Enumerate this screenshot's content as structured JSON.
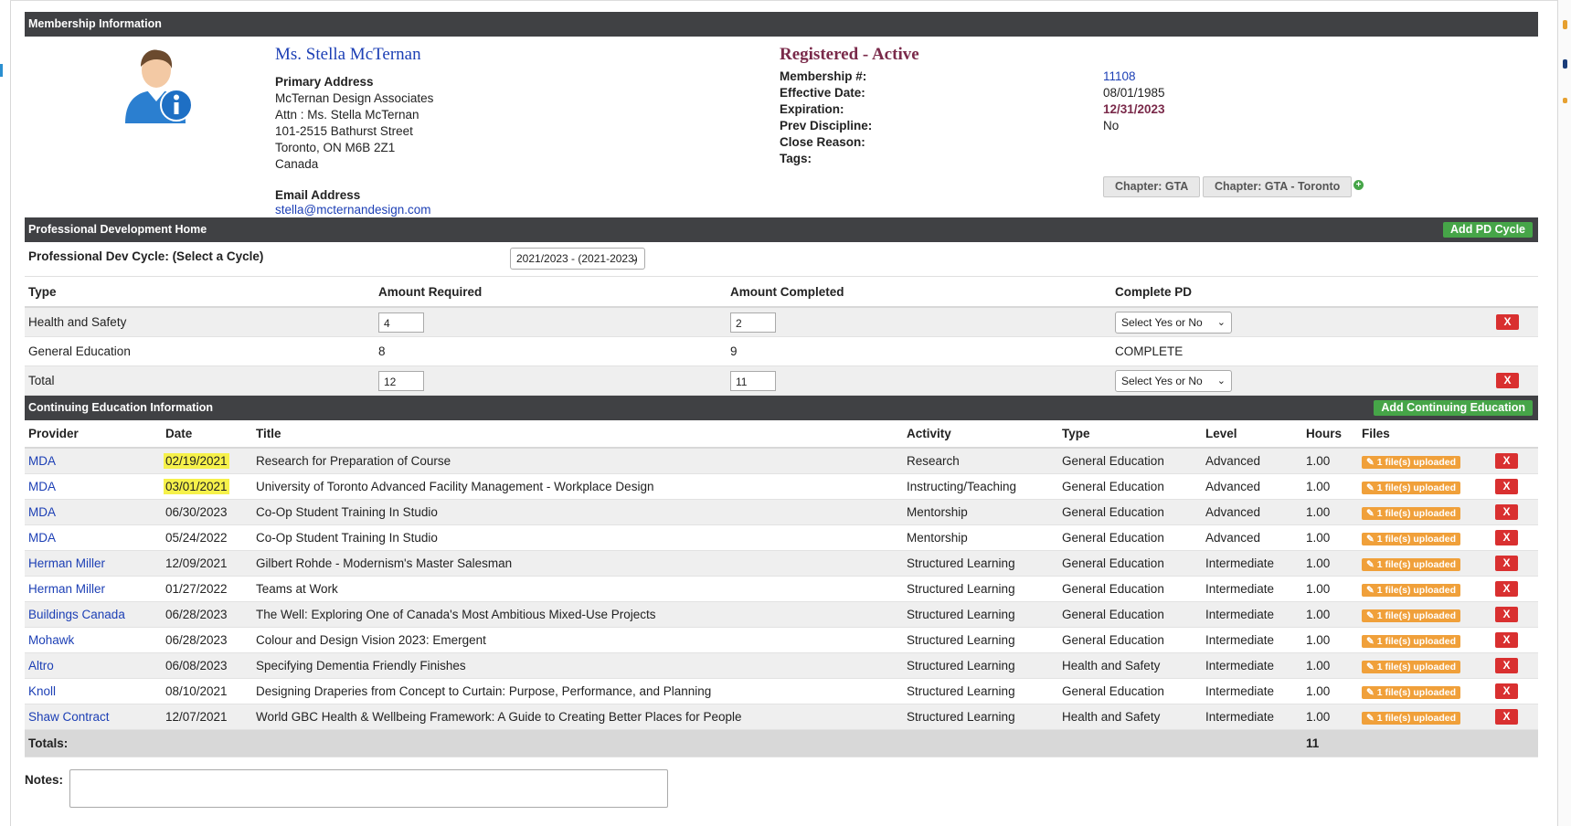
{
  "membership": {
    "section_title": "Membership Information",
    "name": "Ms. Stella McTernan",
    "primary_address_label": "Primary Address",
    "address_lines": [
      "McTernan Design Associates",
      "Attn : Ms. Stella McTernan",
      "101-2515 Bathurst Street",
      "Toronto, ON M6B 2Z1",
      "Canada"
    ],
    "email_label": "Email Address",
    "email": "stella@mcternandesign.com",
    "status": "Registered - Active",
    "fields": [
      {
        "label": "Membership #:",
        "value": "11108"
      },
      {
        "label": "Effective Date:",
        "value": "08/01/1985"
      },
      {
        "label": "Expiration:",
        "value": "12/31/2023"
      },
      {
        "label": "Prev Discipline:",
        "value": "No"
      },
      {
        "label": "Close Reason:",
        "value": ""
      },
      {
        "label": "Tags:",
        "value": ""
      }
    ],
    "tags": [
      "Chapter: GTA",
      "Chapter: GTA - Toronto"
    ],
    "add_tag_icon": "plus-circle-icon"
  },
  "pd": {
    "section_title": "Professional Development Home",
    "add_button": "Add PD Cycle",
    "cycle_label": "Professional Dev Cycle: (Select a Cycle)",
    "cycle_value": "2021/2023 - (2021-2023)",
    "columns": [
      "Type",
      "Amount Required",
      "Amount Completed",
      "Complete PD"
    ],
    "rows": [
      {
        "type": "Health and Safety",
        "required": "4",
        "completed": "2",
        "complete": "Select Yes or No"
      },
      {
        "type": "General Education",
        "required": "8",
        "completed": "9",
        "complete": "COMPLETE"
      },
      {
        "type": "Total",
        "required": "12",
        "completed": "11",
        "complete": "Select Yes or No"
      }
    ]
  },
  "ce": {
    "section_title": "Continuing Education Information",
    "add_button": "Add Continuing Education",
    "columns": [
      "Provider",
      "Date",
      "Title",
      "Activity",
      "Type",
      "Level",
      "Hours",
      "Files"
    ],
    "rows": [
      {
        "provider": "MDA",
        "date": "02/19/2021",
        "title": "Research for Preparation of Course",
        "activity": "Research",
        "type": "General Education",
        "level": "Advanced",
        "hours": "1.00",
        "files": "✎ 1 file(s) uploaded",
        "highlight": true
      },
      {
        "provider": "MDA",
        "date": "03/01/2021",
        "title": "University of Toronto Advanced Facility Management - Workplace Design",
        "activity": "Instructing/Teaching",
        "type": "General Education",
        "level": "Advanced",
        "hours": "1.00",
        "files": "✎ 1 file(s) uploaded",
        "highlight": true
      },
      {
        "provider": "MDA",
        "date": "06/30/2023",
        "title": "Co-Op Student Training In Studio",
        "activity": "Mentorship",
        "type": "General Education",
        "level": "Advanced",
        "hours": "1.00",
        "files": "✎ 1 file(s) uploaded"
      },
      {
        "provider": "MDA",
        "date": "05/24/2022",
        "title": "Co-Op Student Training In Studio",
        "activity": "Mentorship",
        "type": "General Education",
        "level": "Advanced",
        "hours": "1.00",
        "files": "✎ 1 file(s) uploaded"
      },
      {
        "provider": "Herman Miller",
        "date": "12/09/2021",
        "title": "Gilbert Rohde - Modernism's Master Salesman",
        "activity": "Structured Learning",
        "type": "General Education",
        "level": "Intermediate",
        "hours": "1.00",
        "files": "✎ 1 file(s) uploaded"
      },
      {
        "provider": "Herman Miller",
        "date": "01/27/2022",
        "title": "Teams at Work",
        "activity": "Structured Learning",
        "type": "General Education",
        "level": "Intermediate",
        "hours": "1.00",
        "files": "✎ 1 file(s) uploaded"
      },
      {
        "provider": "Buildings Canada",
        "date": "06/28/2023",
        "title": "The Well: Exploring One of Canada's Most Ambitious Mixed-Use Projects",
        "activity": "Structured Learning",
        "type": "General Education",
        "level": "Intermediate",
        "hours": "1.00",
        "files": "✎ 1 file(s) uploaded"
      },
      {
        "provider": "Mohawk",
        "date": "06/28/2023",
        "title": "Colour and Design Vision 2023: Emergent",
        "activity": "Structured Learning",
        "type": "General Education",
        "level": "Intermediate",
        "hours": "1.00",
        "files": "✎ 1 file(s) uploaded"
      },
      {
        "provider": "Altro",
        "date": "06/08/2023",
        "title": "Specifying Dementia Friendly Finishes",
        "activity": "Structured Learning",
        "type": "Health and Safety",
        "level": "Intermediate",
        "hours": "1.00",
        "files": "✎ 1 file(s) uploaded"
      },
      {
        "provider": "Knoll",
        "date": "08/10/2021",
        "title": "Designing Draperies from Concept to Curtain: Purpose, Performance, and Planning",
        "activity": "Structured Learning",
        "type": "General Education",
        "level": "Intermediate",
        "hours": "1.00",
        "files": "✎ 1 file(s) uploaded"
      },
      {
        "provider": "Shaw Contract",
        "date": "12/07/2021",
        "title": "World GBC Health & Wellbeing Framework: A Guide to Creating Better Places for People",
        "activity": "Structured Learning",
        "type": "Health and Safety",
        "level": "Intermediate",
        "hours": "1.00",
        "files": "✎ 1 file(s) uploaded"
      }
    ],
    "totals_label": "Totals:",
    "totals_hours": "11",
    "delete_label": "X"
  },
  "notes": {
    "label": "Notes:"
  },
  "colors": {
    "header_bar": "#404144",
    "accent_green": "#46a548",
    "delete_red": "#d93030",
    "file_orange": "#f0a03a",
    "link_blue": "#1c3fb5",
    "highlight": "#f6f14a"
  }
}
